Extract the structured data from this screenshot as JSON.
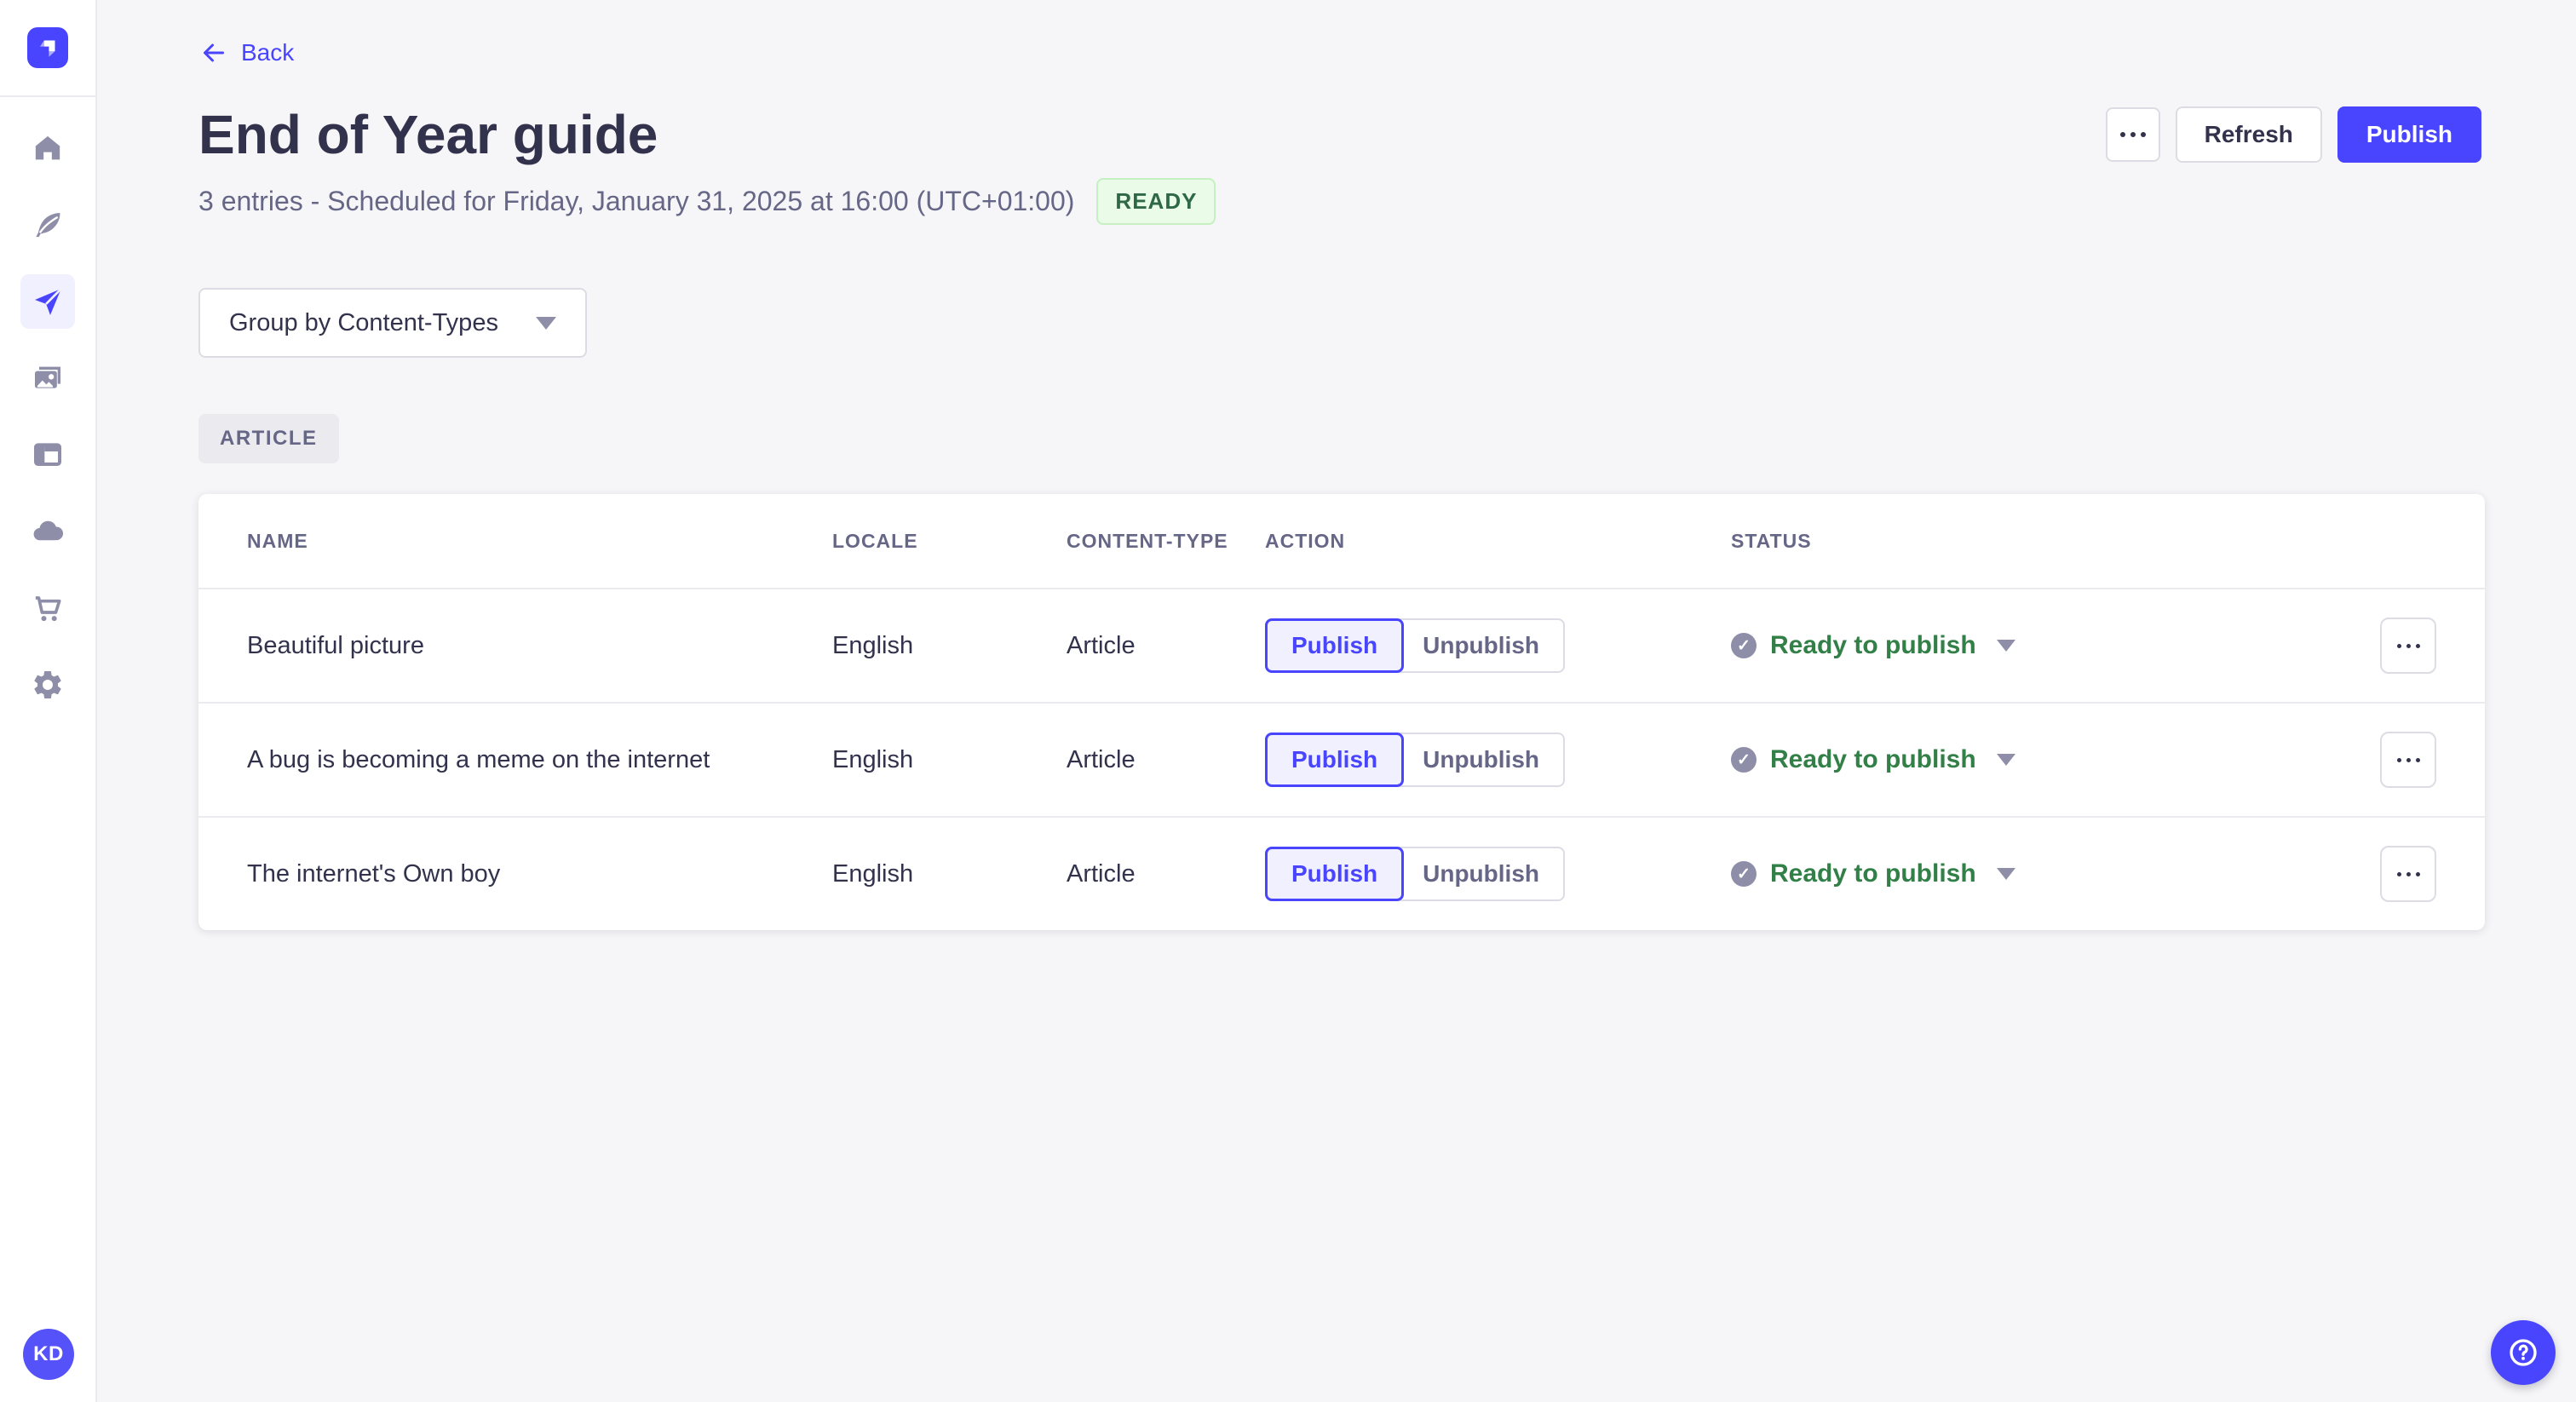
{
  "colors": {
    "accent": "#4945ff",
    "accent_light_bg": "#f0f0ff",
    "success_text": "#328048",
    "success_badge_bg": "#eafbe7",
    "success_badge_border": "#c6f0c2",
    "page_bg": "#f6f6f9",
    "border": "#dcdce4",
    "muted_text": "#666687",
    "icon_gray": "#8e8ea9"
  },
  "sidebar": {
    "logo_icon": "strapi-logo",
    "nav_icons": [
      "home-icon",
      "feather-icon",
      "paper-plane-icon",
      "media-library-icon",
      "layout-icon",
      "cloud-icon",
      "cart-icon",
      "gear-icon"
    ],
    "active_nav": "paper-plane-icon",
    "avatar_initials": "KD"
  },
  "header": {
    "back_label": "Back",
    "back_icon": "arrow-left-icon",
    "title": "End of Year guide",
    "subtitle": "3 entries - Scheduled for Friday, January 31, 2025 at 16:00 (UTC+01:00)",
    "status_badge": "READY",
    "more_icon": "ellipsis-icon",
    "refresh_label": "Refresh",
    "publish_label": "Publish"
  },
  "toolbar": {
    "group_by_label": "Group by Content-Types",
    "group_by_icon": "chevron-down-icon"
  },
  "group": {
    "badge": "ARTICLE"
  },
  "table": {
    "columns": [
      "NAME",
      "LOCALE",
      "CONTENT-TYPE",
      "ACTION",
      "STATUS"
    ],
    "actions": {
      "publish": "Publish",
      "unpublish": "Unpublish"
    },
    "rows": [
      {
        "name": "Beautiful picture",
        "locale": "English",
        "content_type": "Article",
        "status": "Ready to publish"
      },
      {
        "name": "A bug is becoming a meme on the internet",
        "locale": "English",
        "content_type": "Article",
        "status": "Ready to publish"
      },
      {
        "name": "The internet's Own boy",
        "locale": "English",
        "content_type": "Article",
        "status": "Ready to publish"
      }
    ],
    "status_check_glyph": "✓"
  },
  "help": {
    "icon": "question-mark-icon"
  }
}
